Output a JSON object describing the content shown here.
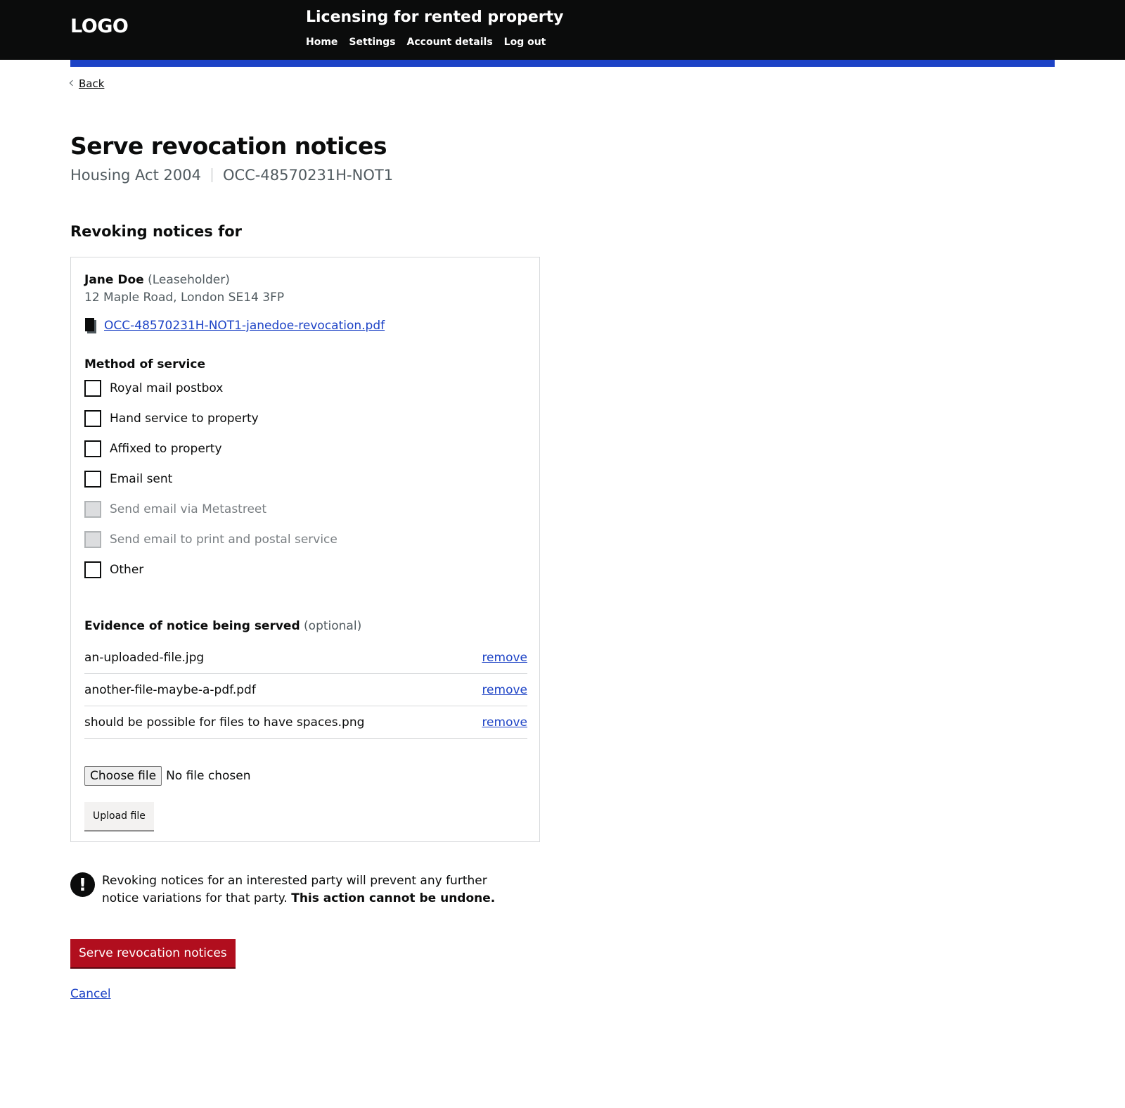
{
  "header": {
    "logo": "LOGO",
    "service_name": "Licensing for rented property",
    "nav": [
      "Home",
      "Settings",
      "Account details",
      "Log out"
    ]
  },
  "back_label": "Back",
  "page": {
    "title": "Serve revocation notices",
    "act": "Housing Act 2004",
    "reference": "OCC-48570231H-NOT1"
  },
  "section_heading": "Revoking notices for",
  "party": {
    "name": "Jane Doe",
    "role": "(Leaseholder)",
    "address": "12 Maple Road, London SE14 3FP",
    "document": "OCC-48570231H-NOT1-janedoe-revocation.pdf"
  },
  "method": {
    "label": "Method of service",
    "options": [
      {
        "label": "Royal mail postbox",
        "disabled": false
      },
      {
        "label": "Hand service to property",
        "disabled": false
      },
      {
        "label": "Affixed to property",
        "disabled": false
      },
      {
        "label": "Email sent",
        "disabled": false
      },
      {
        "label": "Send email via Metastreet",
        "disabled": true
      },
      {
        "label": "Send email to print and postal service",
        "disabled": true
      },
      {
        "label": "Other",
        "disabled": false
      }
    ]
  },
  "evidence": {
    "label": "Evidence of notice being served",
    "optional": "(optional)",
    "files": [
      {
        "name": "an-uploaded-file.jpg",
        "action": "remove"
      },
      {
        "name": "another-file-maybe-a-pdf.pdf",
        "action": "remove"
      },
      {
        "name": "should be possible for files to have spaces.png",
        "action": "remove"
      }
    ],
    "choose_label": "Choose file",
    "no_file": "No file chosen",
    "upload_label": "Upload file"
  },
  "warning": {
    "icon": "!",
    "text": "Revoking notices for an interested party will prevent any further notice variations for that party.",
    "strong": "This action cannot be undone."
  },
  "submit_label": "Serve revocation notices",
  "cancel_label": "Cancel"
}
